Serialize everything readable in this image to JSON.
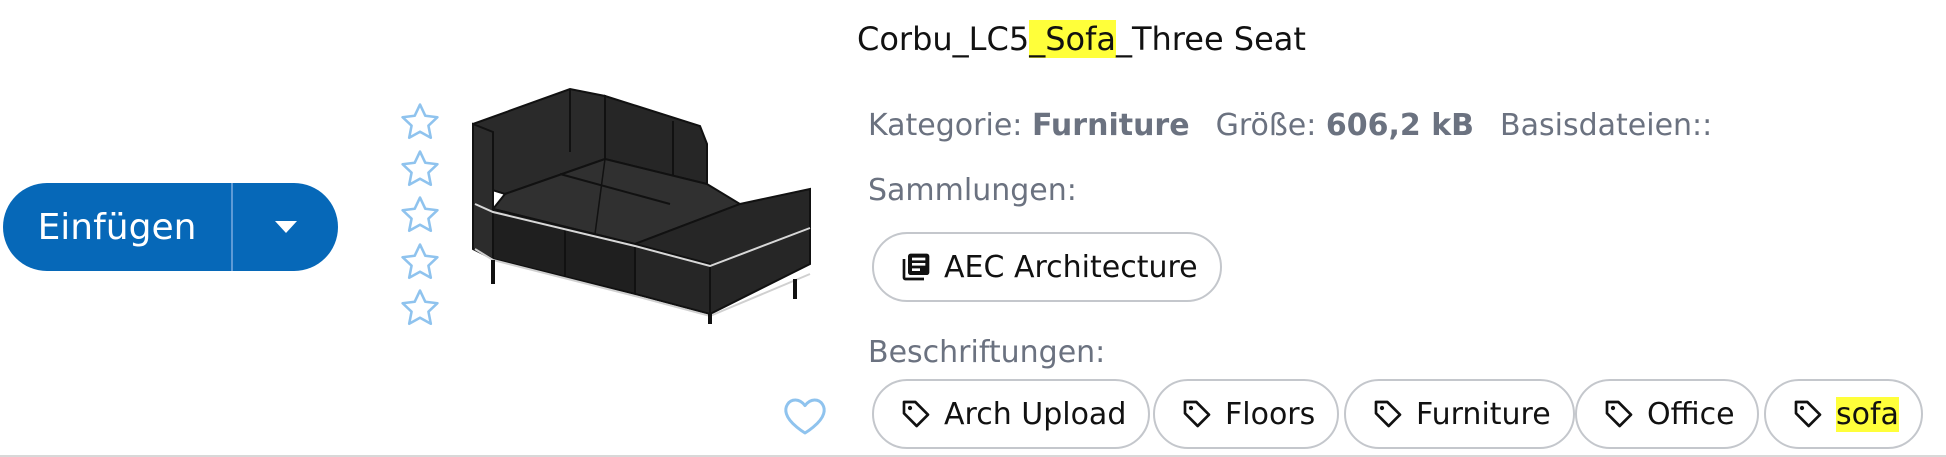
{
  "actions": {
    "insert_label": "Einfügen",
    "dropdown_icon": "caret-down-icon"
  },
  "rating": {
    "stars": 0,
    "max": 5,
    "icon": "star-outline-icon"
  },
  "favorite": {
    "icon": "heart-outline-icon"
  },
  "item": {
    "title_before": "Corbu_LC5",
    "title_highlight": "_Sofa",
    "title_after": "_Three Seat",
    "category_label": "Kategorie:",
    "category_value": "Furniture",
    "size_label": "Größe:",
    "size_value": "606,2 kB",
    "base_files_label": "Basisdateien::",
    "thumbnail": "sofa-thumbnail"
  },
  "collections": {
    "label": "Sammlungen:",
    "items": [
      {
        "label": "AEC Architecture",
        "icon": "library-icon"
      }
    ]
  },
  "tags": {
    "label": "Beschriftungen:",
    "items": [
      {
        "label": "Arch Upload",
        "icon": "tag-icon"
      },
      {
        "label": "Floors",
        "icon": "tag-icon"
      },
      {
        "label": "Furniture",
        "icon": "tag-icon"
      },
      {
        "label": "Office",
        "icon": "tag-icon"
      },
      {
        "label": "sofa",
        "icon": "tag-icon",
        "highlighted": true
      }
    ]
  },
  "colors": {
    "primary": "#0668b8",
    "star_outline": "#8fc3ee",
    "highlight": "#ffff3a",
    "muted_text": "#6b7280",
    "chip_border": "#c4c7cc"
  }
}
